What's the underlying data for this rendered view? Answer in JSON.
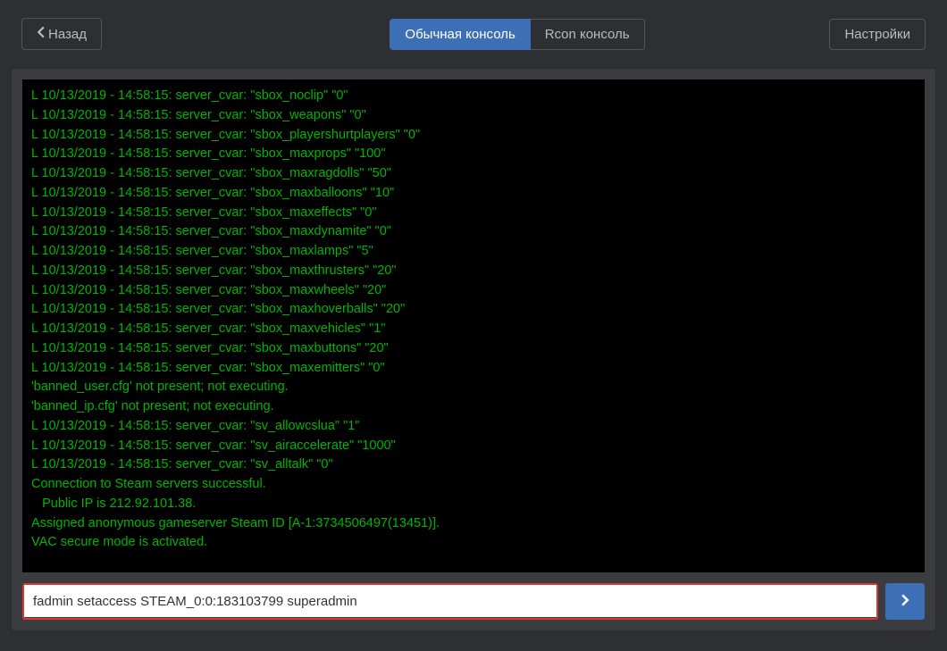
{
  "header": {
    "back_label": "Назад",
    "tab_normal": "Обычная консоль",
    "tab_rcon": "Rcon консоль",
    "settings_label": "Настройки"
  },
  "console": {
    "lines": [
      "L 10/13/2019 - 14:58:15: server_cvar: \"sbox_noclip\" \"0\"",
      "L 10/13/2019 - 14:58:15: server_cvar: \"sbox_weapons\" \"0\"",
      "L 10/13/2019 - 14:58:15: server_cvar: \"sbox_playershurtplayers\" \"0\"",
      "L 10/13/2019 - 14:58:15: server_cvar: \"sbox_maxprops\" \"100\"",
      "L 10/13/2019 - 14:58:15: server_cvar: \"sbox_maxragdolls\" \"50\"",
      "L 10/13/2019 - 14:58:15: server_cvar: \"sbox_maxballoons\" \"10\"",
      "L 10/13/2019 - 14:58:15: server_cvar: \"sbox_maxeffects\" \"0\"",
      "L 10/13/2019 - 14:58:15: server_cvar: \"sbox_maxdynamite\" \"0\"",
      "L 10/13/2019 - 14:58:15: server_cvar: \"sbox_maxlamps\" \"5\"",
      "L 10/13/2019 - 14:58:15: server_cvar: \"sbox_maxthrusters\" \"20\"",
      "L 10/13/2019 - 14:58:15: server_cvar: \"sbox_maxwheels\" \"20\"",
      "L 10/13/2019 - 14:58:15: server_cvar: \"sbox_maxhoverballs\" \"20\"",
      "L 10/13/2019 - 14:58:15: server_cvar: \"sbox_maxvehicles\" \"1\"",
      "L 10/13/2019 - 14:58:15: server_cvar: \"sbox_maxbuttons\" \"20\"",
      "L 10/13/2019 - 14:58:15: server_cvar: \"sbox_maxemitters\" \"0\"",
      "'banned_user.cfg' not present; not executing.",
      "'banned_ip.cfg' not present; not executing.",
      "L 10/13/2019 - 14:58:15: server_cvar: \"sv_allowcslua\" \"1\"",
      "L 10/13/2019 - 14:58:15: server_cvar: \"sv_airaccelerate\" \"1000\"",
      "L 10/13/2019 - 14:58:15: server_cvar: \"sv_alltalk\" \"0\"",
      "Connection to Steam servers successful.",
      "   Public IP is 212.92.101.38.",
      "Assigned anonymous gameserver Steam ID [A-1:3734506497(13451)].",
      "VAC secure mode is activated."
    ]
  },
  "command_input": {
    "value": "fadmin setaccess STEAM_0:0:183103799 superadmin"
  }
}
